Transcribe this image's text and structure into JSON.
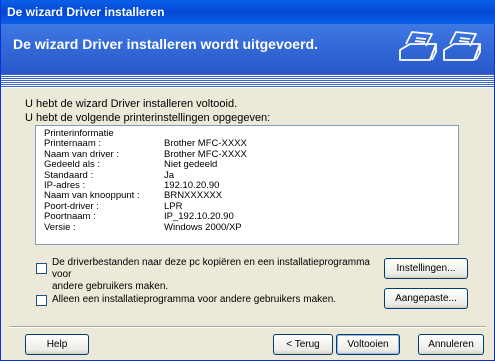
{
  "window": {
    "title": "De wizard Driver installeren"
  },
  "banner": {
    "title": "De wizard Driver installeren wordt uitgevoerd.",
    "icon": "printer-icon"
  },
  "intro": {
    "completed": "U hebt de wizard Driver installeren voltooid.",
    "settings_heading": "U hebt de volgende printerinstellingen opgegeven:"
  },
  "info": {
    "header": "Printerinformatie",
    "rows": [
      {
        "label": "Printernaam :",
        "value": "Brother MFC-XXXX"
      },
      {
        "label": "Naam van driver :",
        "value": "Brother MFC-XXXX"
      },
      {
        "label": "Gedeeld als :",
        "value": "Niet gedeeld"
      },
      {
        "label": "Standaard :",
        "value": "Ja"
      },
      {
        "label": "IP-adres :",
        "value": "192.10.20.90"
      },
      {
        "label": "Naam van knooppunt :",
        "value": "BRNXXXXXX"
      },
      {
        "label": "Poort-driver :",
        "value": "LPR"
      },
      {
        "label": "Poortnaam :",
        "value": "IP_192.10.20.90"
      },
      {
        "label": "Versie :",
        "value": "Windows 2000/XP"
      }
    ]
  },
  "options": {
    "copy_label_1": "De driverbestanden naar deze pc kopiëren en een installatieprogramma voor",
    "copy_label_2": "andere gebruikers maken.",
    "installer_only_label": "Alleen een installatieprogramma voor andere gebruikers maken.",
    "settings_button": "Instellingen...",
    "custom_button": "Aangepaste..."
  },
  "footer": {
    "help": "Help",
    "back": "< Terug",
    "finish": "Voltooien",
    "cancel": "Annuleren"
  }
}
